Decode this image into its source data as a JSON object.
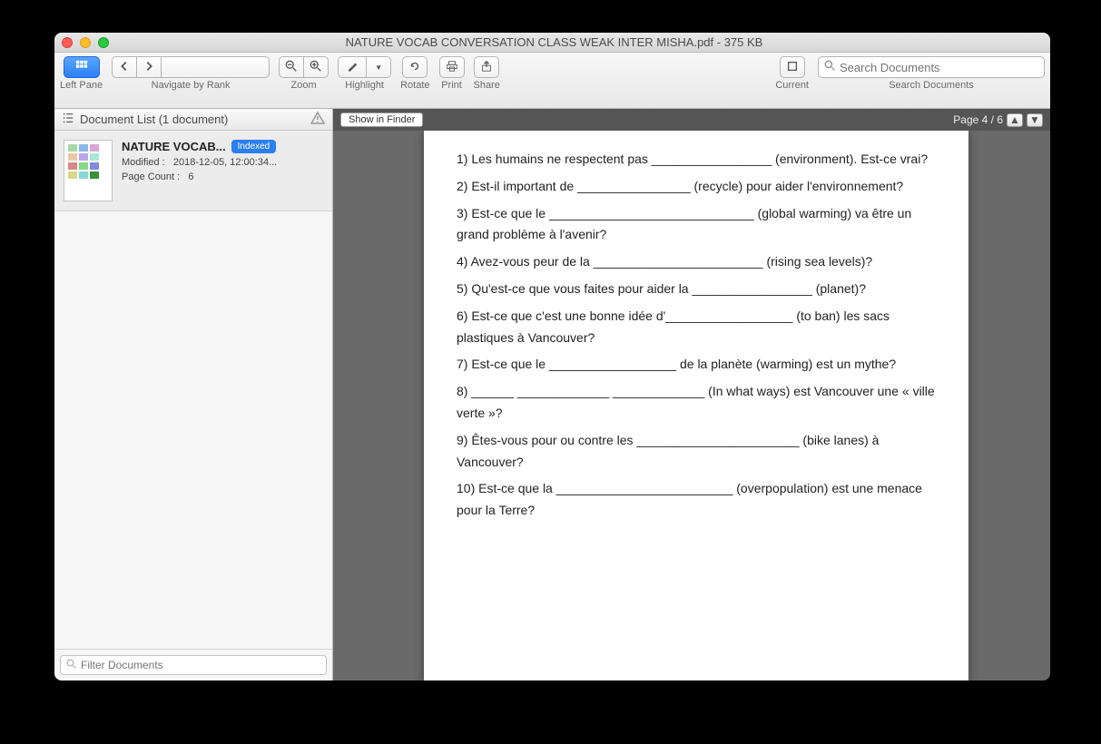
{
  "window": {
    "title": "NATURE VOCAB CONVERSATION CLASS WEAK INTER MISHA.pdf - 375 KB"
  },
  "toolbar": {
    "left_pane": "Left Pane",
    "navigate": "Navigate by Rank",
    "zoom": "Zoom",
    "highlight": "Highlight",
    "rotate": "Rotate",
    "print": "Print",
    "share": "Share",
    "current": "Current",
    "search_docs": "Search Documents"
  },
  "search": {
    "placeholder": "Search Documents"
  },
  "sidebar": {
    "header": "Document List (1 document)",
    "doc": {
      "title": "NATURE VOCAB...",
      "badge": "Indexed",
      "modified_label": "Modified :",
      "modified_value": "2018-12-05, 12:00:34...",
      "pagecount_label": "Page Count :",
      "pagecount_value": "6"
    },
    "filter_placeholder": "Filter Documents"
  },
  "viewer": {
    "show_finder": "Show in Finder",
    "page_indicator": "Page 4 / 6"
  },
  "document": {
    "lines": [
      "1) Les humains ne respectent pas _________________ (environment). Est-ce vrai?",
      "2) Est-il important de ________________ (recycle) pour aider l'environnement?",
      "3) Est-ce que le _____________________________ (global warming) va être un grand problème à l'avenir?",
      "4) Avez-vous peur de la ________________________ (rising sea levels)?",
      "5) Qu'est-ce que vous faites pour aider la _________________ (planet)?",
      "6) Est-ce que c'est une bonne idée d'__________________ (to ban) les sacs plastiques à Vancouver?",
      "7) Est-ce que le __________________ de la planète (warming) est un mythe?",
      "8) ______ _____________ _____________ (In what ways) est Vancouver une « ville verte »?",
      "9) Êtes-vous pour ou contre les _______________________ (bike lanes) à Vancouver?",
      "10) Est-ce que la _________________________ (overpopulation) est une menace pour la Terre?"
    ]
  }
}
